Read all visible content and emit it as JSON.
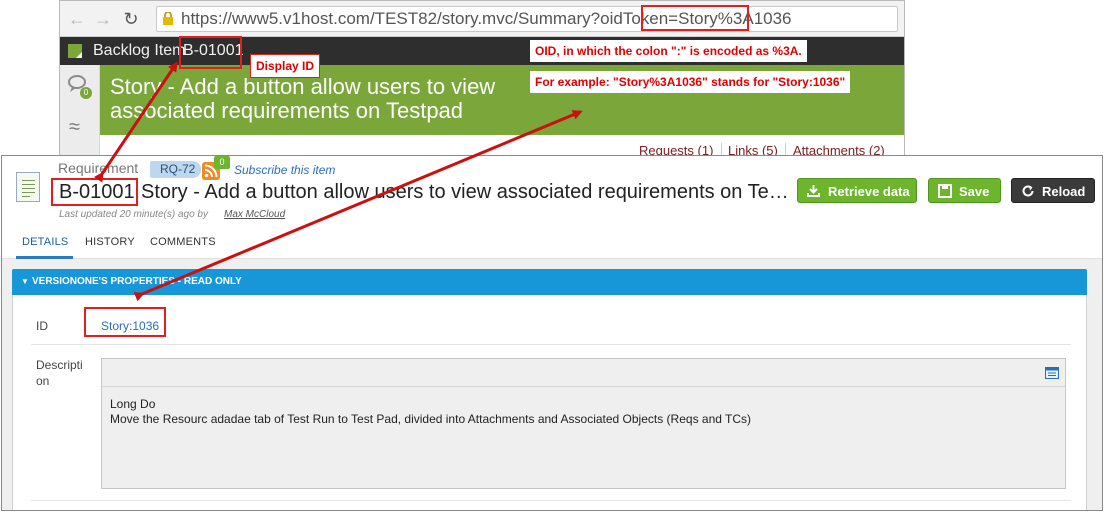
{
  "browser": {
    "url_prefix": "https://www5.v1host.com/TEST82/story.mvc/Summary?oidToken=",
    "url_token": "Story%3A1036",
    "backlog_label": "Backlog Item",
    "backlog_id": "B-01001",
    "conversation_count": "0",
    "banner_title": "Story - Add a button allow users to view associated requirements on Testpad",
    "tabs": {
      "requests": "Requests (1)",
      "links": "Links (5)",
      "attachments": "Attachments (2)"
    }
  },
  "panel": {
    "type_label": "Requirement",
    "req_badge": "RQ-72",
    "rss_count": "0",
    "subscribe_link": "Subscribe this item",
    "display_id": "B-01001",
    "title": "Story - Add a button allow users to view associated requirements on Te…",
    "updated_prefix": "Last updated 20 minute(s) ago by",
    "updated_user": "Max McCloud",
    "buttons": {
      "retrieve": "Retrieve data",
      "save": "Save",
      "reload": "Reload"
    },
    "tabs": [
      "DETAILS",
      "HISTORY",
      "COMMENTS"
    ],
    "section_title": "VERSIONONE'S PROPERTIES - READ ONLY",
    "id_label": "ID",
    "id_value": "Story:1036",
    "description_label_line1": "Descripti",
    "description_label_line2": "on",
    "description_line1": "Long Do",
    "description_line2": "Move the Resourc adadae tab of Test Run to Test Pad, divided into Attachments and Associated Objects (Reqs and TCs)"
  },
  "annotations": {
    "display_id_note": "Display ID",
    "oid_note_line1": "OID, in which the colon \":\" is encoded as %3A.",
    "oid_note_line2": "For example: \"Story%3A1036\" stands for \"Story:1036\""
  },
  "colors": {
    "banner_green": "#7aa63a",
    "section_blue": "#1796d8",
    "button_green": "#6cb52d",
    "button_dark": "#3a3a3a",
    "annotation_red": "#e02020",
    "link_blue": "#2a6ebb"
  }
}
